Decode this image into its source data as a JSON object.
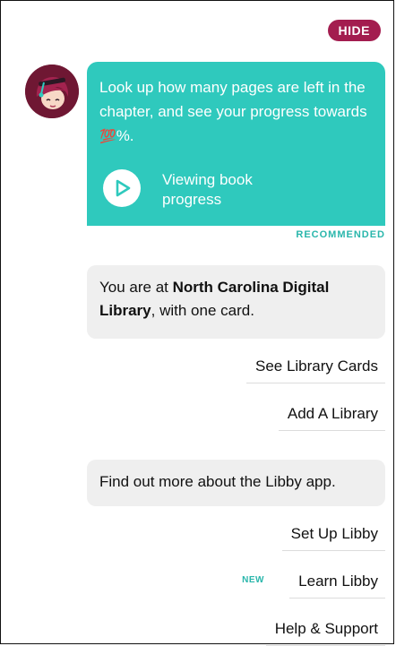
{
  "header": {
    "hide_label": "HIDE"
  },
  "assistant": {
    "avatar_icon": "libby-avatar-icon",
    "card": {
      "text_pre": "Look up how many pages are left in the chapter, and see your progress towards ",
      "emoji": "💯",
      "text_post": "%.",
      "action_icon": "play-circle-icon",
      "action_label": "Viewing book progress",
      "tag": "RECOMMENDED"
    }
  },
  "library": {
    "text_pre": "You are at ",
    "library_name": "North Carolina Digital Library",
    "text_post": ", with one card.",
    "actions": [
      {
        "label": "See Library Cards"
      },
      {
        "label": "Add A Library"
      }
    ]
  },
  "about": {
    "text": "Find out more about the Libby app.",
    "actions": [
      {
        "label": "Set Up Libby"
      },
      {
        "label": "Learn Libby",
        "badge": "NEW"
      },
      {
        "label": "Help & Support"
      }
    ]
  },
  "colors": {
    "accent": "#a31d4f",
    "teal": "#2fc9bd",
    "bubble": "#efefef"
  }
}
